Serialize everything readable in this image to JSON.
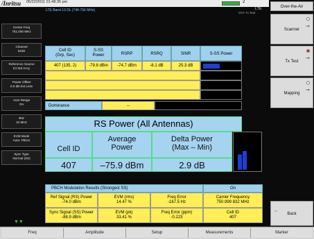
{
  "status": {
    "logo": "/Inritsu",
    "datetime": "05/22/2011 01:48:36 pm",
    "battery_level": "2"
  },
  "header": {
    "band": "LTE Band 13 DL (746-756 MHz)",
    "mode": "LTE",
    "subtitle": "OTA Tx Test"
  },
  "left_menu": [
    {
      "label": "Center Freq",
      "value": "751.000 MHz"
    },
    {
      "label": "Channel",
      "value": "5230"
    },
    {
      "label": "Reference Source",
      "value": "Int Std Accy"
    },
    {
      "label": "Power Offset",
      "value": "0.0 dB Ext Loss"
    },
    {
      "label": "Auto Range",
      "value": "On"
    },
    {
      "label": "BW",
      "value": "10 MHz"
    },
    {
      "label": "EVM Mode",
      "value": "Auto: PBCH"
    },
    {
      "label": "Sync Type",
      "value": "Normal (SS)"
    }
  ],
  "table": {
    "headers": [
      "Cell ID\n(Grp, Sec)",
      "S-SS\nPower",
      "RSRP",
      "RSRQ",
      "SINR",
      "S-SS Power"
    ],
    "rows": [
      [
        "407 (135, 2)",
        "-79.8 dBm",
        "-74.7 dBm",
        "-8.1 dB",
        "25.3 dB",
        ""
      ],
      [
        "",
        "",
        "",
        "",
        "",
        ""
      ],
      [
        "",
        "",
        "",
        "",
        "",
        ""
      ],
      [
        "",
        "",
        "",
        "",
        "",
        ""
      ]
    ],
    "sss_bar_fraction": 0.45,
    "dominance_label": "Dominance",
    "dominance_value": "--"
  },
  "rs_power": {
    "title": "RS Power (All Antennas)",
    "col_cell": "Cell ID",
    "col_avg": "Average\nPower",
    "col_delta": "Delta Power\n(Max – Min)",
    "cell_id": "407",
    "avg_power": "–75.9 dBm",
    "delta_power": "2.9 dB",
    "bar_fraction_1": 0.4,
    "bar_fraction_2": 0.5
  },
  "pbch": {
    "title": "PBCH Modulation Results (Strongest SS)",
    "status": "On",
    "cells": [
      {
        "label": "Ref Signal (RS) Power",
        "value": "-74.0 dBm"
      },
      {
        "label": "EVM (rms)",
        "value": "14.47 %"
      },
      {
        "label": "Freq Error",
        "value": "-167.5 Hz"
      },
      {
        "label": "Carrier Frequency",
        "value": "750.999 832 MHz"
      },
      {
        "label": "Sync Signal (SS) Power",
        "value": "-88.9 dBm"
      },
      {
        "label": "EVM (pk)",
        "value": "33.41 %"
      },
      {
        "label": "Freq Error (ppm)",
        "value": "-0.223"
      },
      {
        "label": "Cell ID",
        "value": "407"
      }
    ]
  },
  "right_menu": {
    "title": "Over-the-Air",
    "items": [
      "Scanner",
      "Tx Test",
      "Mapping"
    ],
    "back": "Back"
  },
  "bottom_menu": [
    "Freq",
    "Amplitude",
    "Setup",
    "Measurements",
    "Marker"
  ],
  "colors": {
    "accent": "#2fb33a",
    "header_blue": "#9fd0ef",
    "highlight_yellow": "#ffee55",
    "bar_blue": "#1f3fd0"
  }
}
